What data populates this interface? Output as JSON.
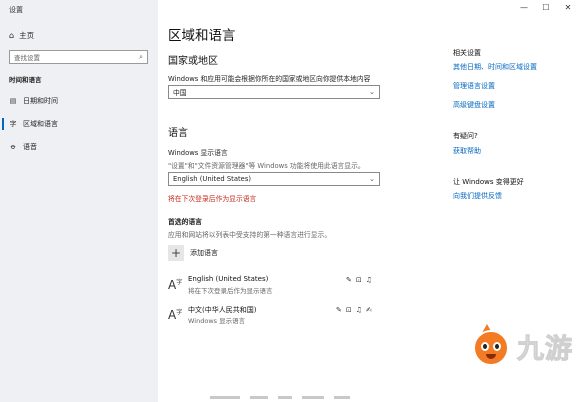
{
  "window": {
    "title": "设置",
    "controls": {
      "minimize": "—",
      "maximize": "☐",
      "close": "✕"
    }
  },
  "nav": {
    "home": "主页",
    "search_placeholder": "查找设置",
    "section": "时间和语言",
    "items": [
      {
        "label": "日期和时间",
        "icon": "calendar-clock-icon",
        "glyph": "▤"
      },
      {
        "label": "区域和语言",
        "icon": "region-language-icon",
        "glyph": "字",
        "active": true
      },
      {
        "label": "语音",
        "icon": "microphone-icon",
        "glyph": "🎙"
      }
    ]
  },
  "main": {
    "title": "区域和语言",
    "region": {
      "heading": "国家或地区",
      "description": "Windows 和应用可能会根据你所在的国家或地区向你提供本地内容",
      "value": "中国"
    },
    "language": {
      "heading": "语言",
      "display_label": "Windows 显示语言",
      "display_desc": "\"设置\"和\"文件资源管理器\"等 Windows 功能将使用此语言显示。",
      "display_value": "English (United States)",
      "warning": "将在下次登录后作为显示语言",
      "preferred_heading": "首选的语言",
      "preferred_desc": "应用和网站将以列表中受支持的第一种语言进行显示。",
      "add_label": "添加语言",
      "list": [
        {
          "name": "English (United States)",
          "sub": "将在下次登录后作为显示语言",
          "features": [
            "✎",
            "⊡",
            "♫"
          ]
        },
        {
          "name": "中文(中华人民共和国)",
          "sub": "Windows 显示语言",
          "features": [
            "✎",
            "⊡",
            "♫",
            "✍"
          ]
        }
      ]
    }
  },
  "related": {
    "heading": "相关设置",
    "links": [
      "其他日期、时间和区域设置",
      "管理语言设置",
      "高级键盘设置"
    ],
    "question_heading": "有疑问?",
    "help_link": "获取帮助",
    "improve_heading": "让 Windows 变得更好",
    "feedback_link": "向我们提供反馈"
  },
  "watermark": {
    "text": "九游"
  },
  "colors": {
    "accent": "#0067c0",
    "warning": "#c42b1c",
    "nav_bg": "#eef0f3",
    "logo_orange": "#f27b23"
  }
}
